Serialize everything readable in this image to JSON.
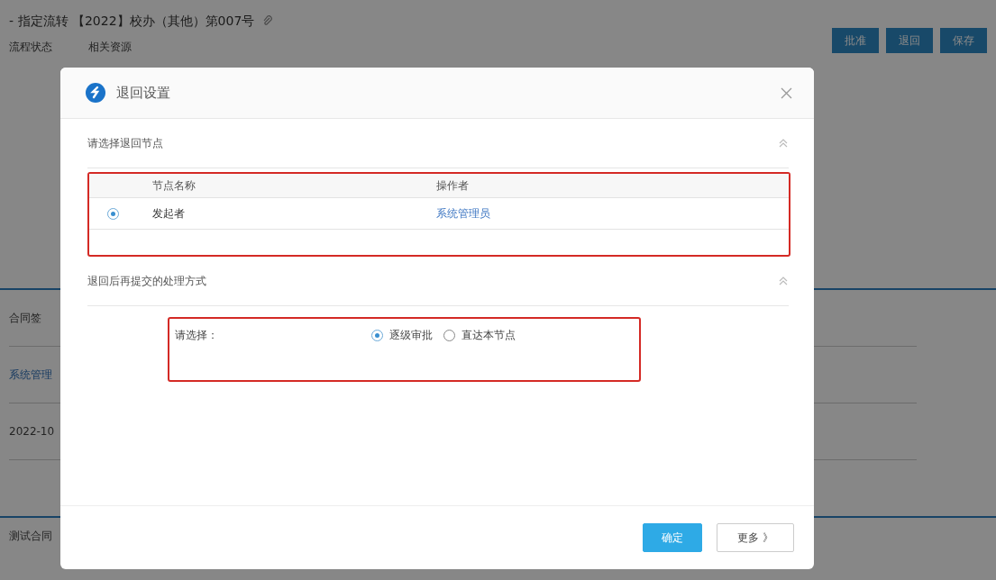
{
  "page": {
    "title": "- 指定流转 【2022】校办（其他）第007号",
    "tabs": [
      "流程状态",
      "相关资源"
    ],
    "actions": [
      "批准",
      "退回",
      "保存"
    ],
    "fields": [
      "合同签",
      "系统管理",
      "2022-10"
    ],
    "footer_text": "测试合同"
  },
  "dialog": {
    "title": "退回设置",
    "section_1": {
      "title": "请选择退回节点",
      "columns": [
        "节点名称",
        "操作者"
      ],
      "rows": [
        {
          "selected": true,
          "node": "发起者",
          "operator": "系统管理员"
        }
      ]
    },
    "section_2": {
      "title": "退回后再提交的处理方式",
      "label": "请选择：",
      "options": [
        {
          "label": "逐级审批",
          "selected": true
        },
        {
          "label": "直达本节点",
          "selected": false
        }
      ]
    },
    "buttons": [
      {
        "label": "确定",
        "kind": "primary"
      },
      {
        "label": "更多 》",
        "kind": "default"
      }
    ]
  }
}
